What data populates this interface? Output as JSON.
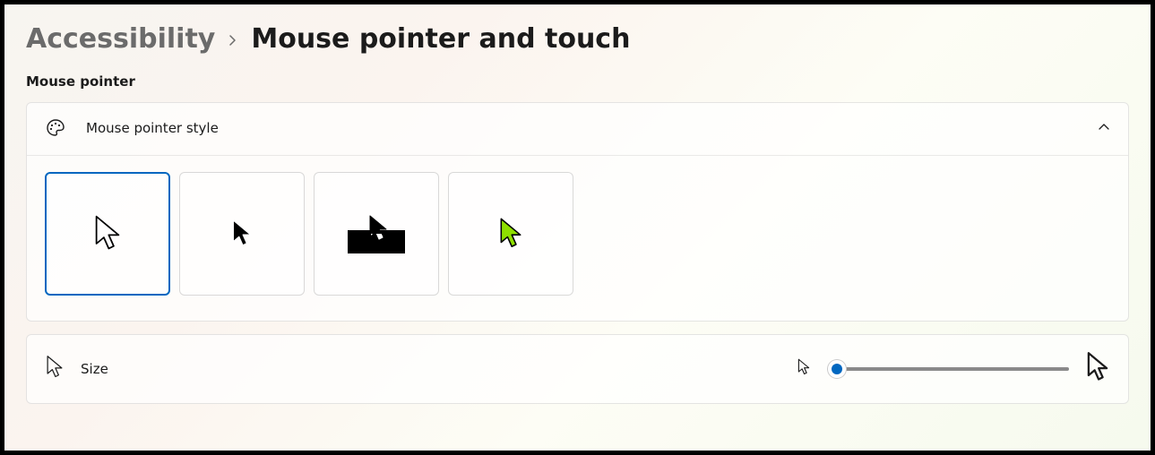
{
  "breadcrumb": {
    "parent": "Accessibility",
    "current": "Mouse pointer and touch"
  },
  "section": {
    "title": "Mouse pointer"
  },
  "style_card": {
    "label": "Mouse pointer style",
    "options": [
      {
        "id": "white",
        "selected": true
      },
      {
        "id": "black",
        "selected": false
      },
      {
        "id": "inverted",
        "selected": false
      },
      {
        "id": "custom",
        "selected": false
      }
    ],
    "custom_color": "#7ed321"
  },
  "size_card": {
    "label": "Size",
    "value": 1,
    "min": 1,
    "max": 15
  },
  "colors": {
    "accent": "#0067c0"
  }
}
